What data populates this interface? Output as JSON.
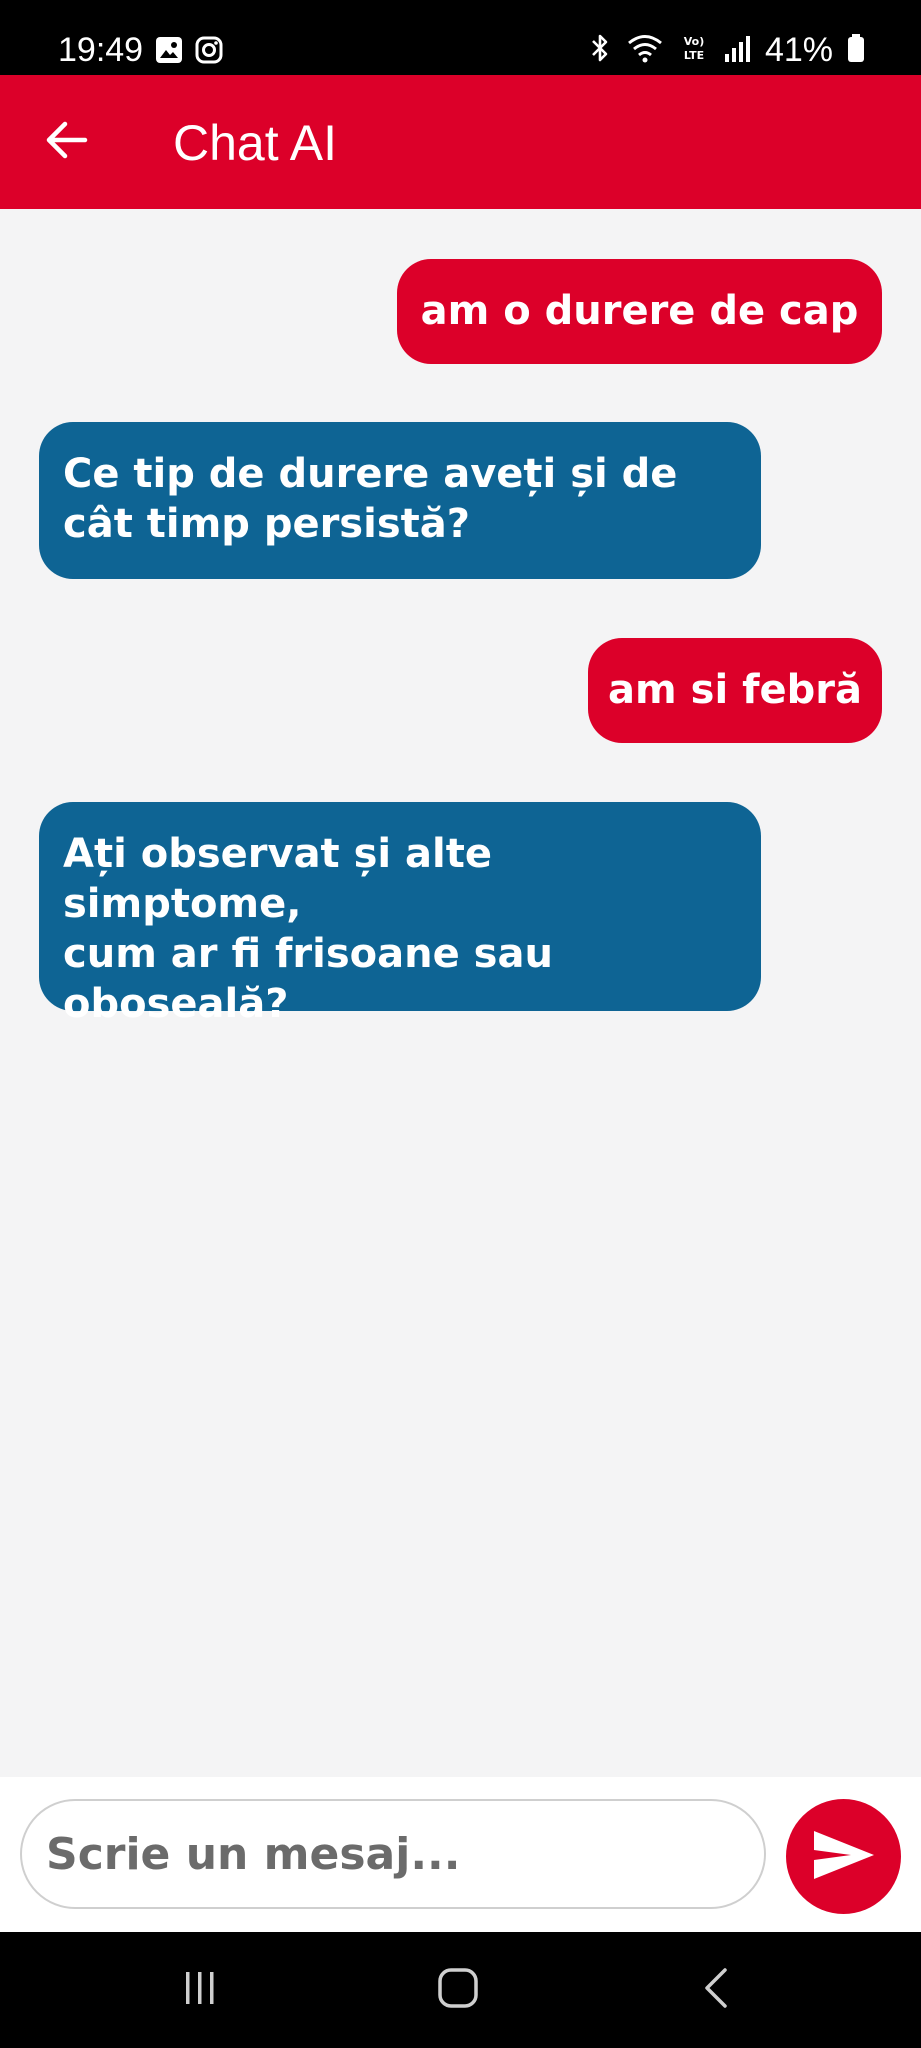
{
  "status_bar": {
    "time": "19:49",
    "battery": "41%",
    "icons": [
      "gallery-icon",
      "instagram-icon",
      "bluetooth-icon",
      "wifi-icon",
      "volte-icon",
      "signal-icon",
      "battery-icon"
    ]
  },
  "app_bar": {
    "title": "Chat AI",
    "back_icon": "arrow-left-icon",
    "background": "#dc0029"
  },
  "messages": [
    {
      "sender": "user",
      "text": "am o durere de cap"
    },
    {
      "sender": "bot",
      "text": "Ce tip de durere aveți și de\ncât timp persistă?"
    },
    {
      "sender": "user",
      "text": "am si febră"
    },
    {
      "sender": "bot",
      "text": "Ați observat și alte simptome,\ncum ar fi frisoane sau\noboseală?"
    }
  ],
  "colors": {
    "user_bubble": "#dc0029",
    "bot_bubble": "#0e6494",
    "chat_background": "#f4f4f5"
  },
  "composer": {
    "placeholder": "Scrie un mesaj...",
    "value": "",
    "send_icon": "send-icon"
  },
  "nav_bar": {
    "buttons": [
      "recents-icon",
      "home-icon",
      "back-icon"
    ]
  }
}
